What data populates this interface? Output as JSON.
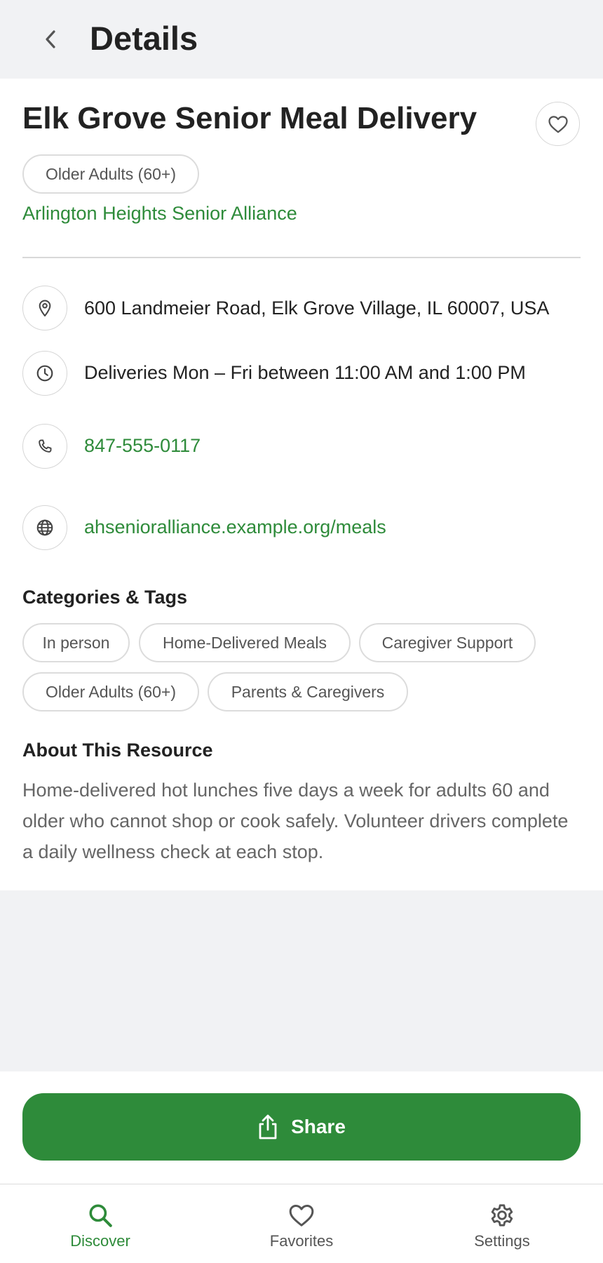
{
  "header": {
    "title": "Details"
  },
  "resource": {
    "title": "Elk Grove Senior Meal Delivery",
    "audience_chip": "Older Adults (60+)",
    "organization": "Arlington Heights Senior Alliance",
    "address": "600 Landmeier Road, Elk Grove Village, IL 60007, USA",
    "hours": "Deliveries Mon – Fri between 11:00 AM and 1:00 PM",
    "phone": "847-555-0117",
    "website": "ahsenioralliance.example.org/meals"
  },
  "categories": {
    "heading": "Categories & Tags",
    "tags": [
      "In person",
      "Home-Delivered Meals",
      "Caregiver Support",
      "Older Adults (60+)",
      "Parents & Caregivers"
    ]
  },
  "about": {
    "heading": "About This Resource",
    "text": "Home-delivered hot lunches five days a week for adults 60 and older who cannot shop or cook safely. Volunteer drivers complete a daily wellness check at each stop."
  },
  "share": {
    "label": "Share"
  },
  "tabs": [
    {
      "label": "Discover",
      "icon": "search-icon",
      "active": true
    },
    {
      "label": "Favorites",
      "icon": "heart-icon",
      "active": false
    },
    {
      "label": "Settings",
      "icon": "gear-icon",
      "active": false
    }
  ],
  "colors": {
    "accent": "#2e8b3a",
    "background": "#f1f2f4",
    "card": "#ffffff",
    "muted_text": "#666666"
  }
}
